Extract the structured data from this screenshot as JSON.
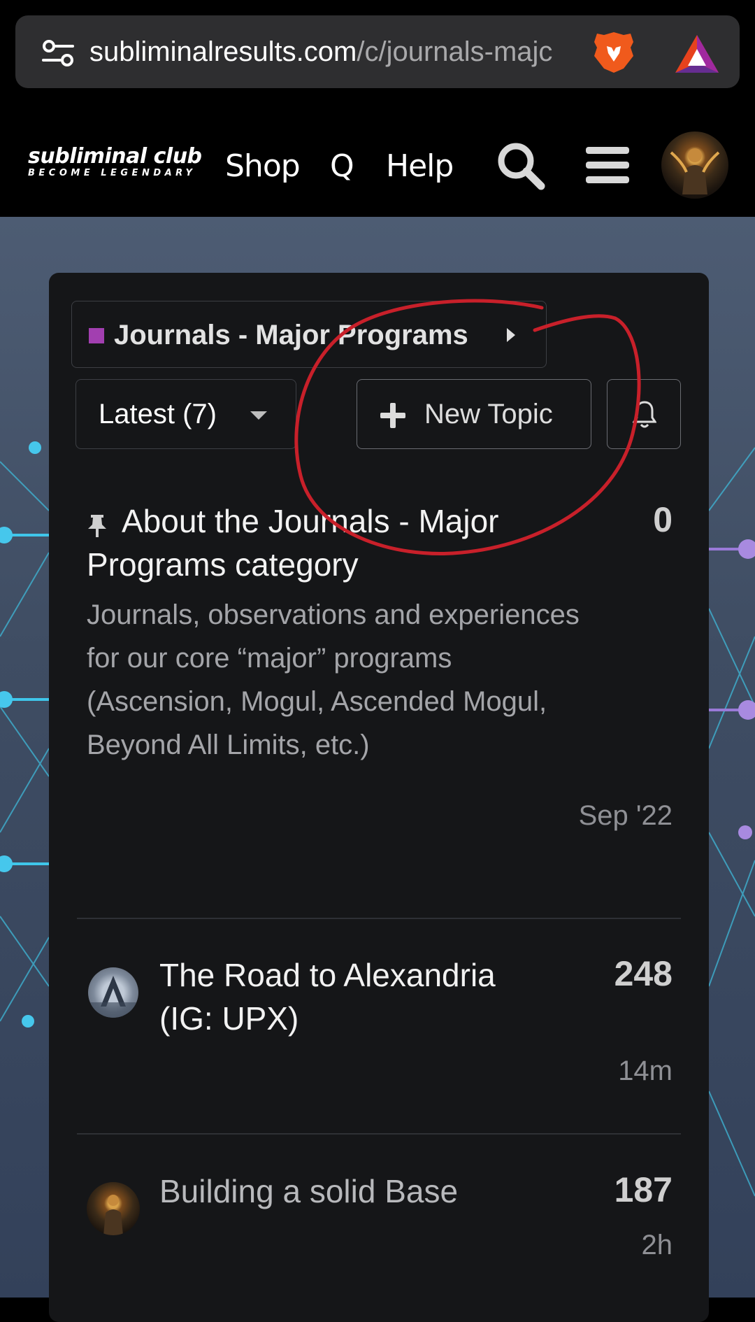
{
  "browser": {
    "url_domain": "subliminalresults.com",
    "url_path": "/c/journals-majc"
  },
  "header": {
    "logo_main": "subliminal club",
    "logo_sub": "BECOME LEGENDARY",
    "nav": [
      "Shop",
      "Q",
      "Help"
    ]
  },
  "category": {
    "name": "Journals - Major Programs",
    "color": "#a23fb0"
  },
  "controls": {
    "filter_label": "Latest (7)",
    "new_topic_label": "New Topic"
  },
  "topics": [
    {
      "title": "About the Journals - Major Programs category",
      "excerpt": "Journals, observations and experiences for our core “major” programs (Ascension, Mogul, Ascended Mogul, Beyond All Limits, etc.)",
      "count": "0",
      "time": "Sep '22",
      "pinned": true
    },
    {
      "title": "The Road to Alexandria (IG: UPX)",
      "count": "248",
      "time": "14m"
    },
    {
      "title": "Building a solid Base",
      "count": "187",
      "time": "2h"
    }
  ],
  "colors": {
    "annotation_stroke": "#c8202a",
    "card_bg": "#151618"
  }
}
